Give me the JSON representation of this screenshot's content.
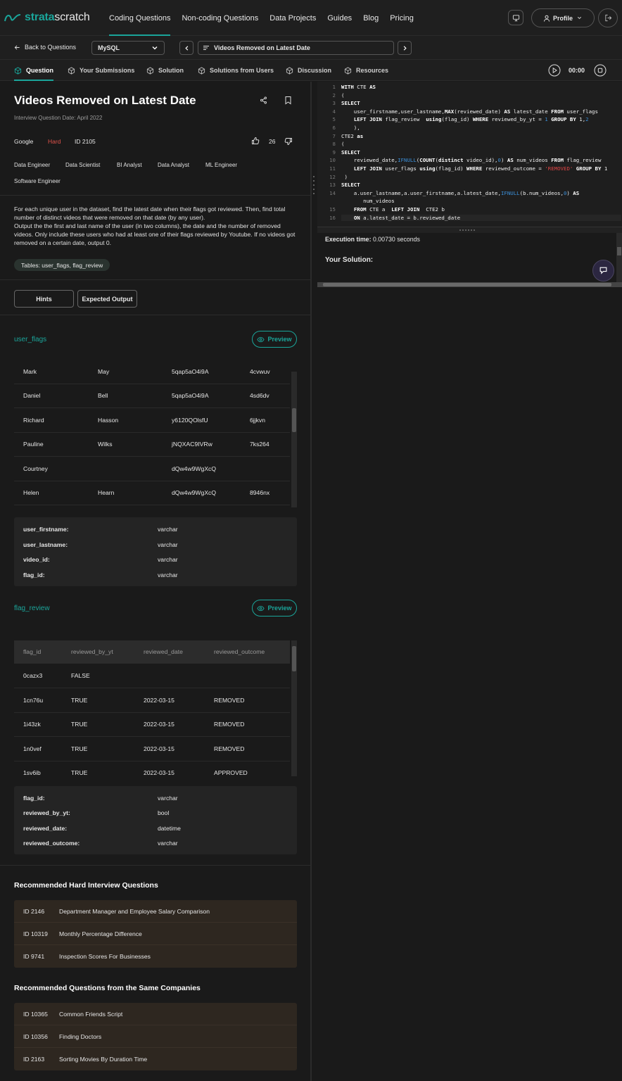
{
  "brand": {
    "logo_bold": "strata",
    "logo_rest": "scratch"
  },
  "nav": [
    "Coding Questions",
    "Non-coding Questions",
    "Data Projects",
    "Guides",
    "Blog",
    "Pricing"
  ],
  "profile_label": "Profile",
  "toolbar": {
    "back_label": "Back to Questions",
    "language": "MySQL",
    "question_title": "Videos Removed on Latest Date"
  },
  "tabs": [
    "Question",
    "Your Submissions",
    "Solution",
    "Solutions from Users",
    "Discussion",
    "Resources"
  ],
  "timer": "00:00",
  "question": {
    "title": "Videos Removed on Latest Date",
    "date": "Interview Question Date: April 2022",
    "company": "Google",
    "difficulty": "Hard",
    "id": "ID 2105",
    "likes": "26",
    "roles": [
      "Data Engineer",
      "Data Scientist",
      "BI Analyst",
      "Data Analyst",
      "ML Engineer",
      "Software Engineer"
    ],
    "description": "For each unique user in the dataset, find the latest date when their flags got reviewed. Then, find total number of distinct videos that were removed on that date (by any user).\nOutput the the first and last name of the user (in two columns), the date and the number of removed videos. Only include these users who had at least one of their flags reviewed by Youtube. If no videos got removed on a certain date, output 0.",
    "tables_pill": "Tables: user_flags, flag_review"
  },
  "buttons": {
    "hints": "Hints",
    "expected": "Expected Output",
    "preview": "Preview"
  },
  "user_flags": {
    "name": "user_flags",
    "rows": [
      [
        "Mark",
        "May",
        "5qap5aO4i9A",
        "4cvwuv"
      ],
      [
        "Daniel",
        "Bell",
        "5qap5aO4i9A",
        "4sd6dv"
      ],
      [
        "Richard",
        "Hasson",
        "y6120QOlsfU",
        "6jjkvn"
      ],
      [
        "Pauline",
        "Wilks",
        "jNQXAC9IVRw",
        "7ks264"
      ],
      [
        "Courtney",
        "",
        "dQw4w9WgXcQ",
        ""
      ],
      [
        "Helen",
        "Hearn",
        "dQw4w9WgXcQ",
        "8946nx"
      ]
    ],
    "schema": [
      [
        "user_firstname:",
        "varchar"
      ],
      [
        "user_lastname:",
        "varchar"
      ],
      [
        "video_id:",
        "varchar"
      ],
      [
        "flag_id:",
        "varchar"
      ]
    ]
  },
  "flag_review": {
    "name": "flag_review",
    "headers": [
      "flag_id",
      "reviewed_by_yt",
      "reviewed_date",
      "reviewed_outcome"
    ],
    "rows": [
      [
        "0cazx3",
        "FALSE",
        "",
        ""
      ],
      [
        "1cn76u",
        "TRUE",
        "2022-03-15",
        "REMOVED"
      ],
      [
        "1i43zk",
        "TRUE",
        "2022-03-15",
        "REMOVED"
      ],
      [
        "1n0vef",
        "TRUE",
        "2022-03-15",
        "REMOVED"
      ],
      [
        "1sv6ib",
        "TRUE",
        "2022-03-15",
        "APPROVED"
      ]
    ],
    "schema": [
      [
        "flag_id:",
        "varchar"
      ],
      [
        "reviewed_by_yt:",
        "bool"
      ],
      [
        "reviewed_date:",
        "datetime"
      ],
      [
        "reviewed_outcome:",
        "varchar"
      ]
    ]
  },
  "rec_hard": {
    "title": "Recommended Hard Interview Questions",
    "items": [
      [
        "ID 2146",
        "Department Manager and Employee Salary Comparison"
      ],
      [
        "ID 10319",
        "Monthly Percentage Difference"
      ],
      [
        "ID 9741",
        "Inspection Scores For Businesses"
      ]
    ]
  },
  "rec_same": {
    "title": "Recommended Questions from the Same Companies",
    "items": [
      [
        "ID 10365",
        "Common Friends Script"
      ],
      [
        "ID 10356",
        "Finding Doctors"
      ],
      [
        "ID 2163",
        "Sorting Movies By Duration Time"
      ]
    ]
  },
  "code_lines": [
    "WITH CTE AS",
    "(",
    "SELECT",
    "    user_firstname,user_lastname,MAX(reviewed_date) AS latest_date FROM user_flags",
    "    LEFT JOIN flag_review  using(flag_id) WHERE reviewed_by_yt = 1 GROUP BY 1,2",
    "    ),",
    "CTE2 as",
    "(",
    "SELECT",
    "    reviewed_date,IFNULL(COUNT(distinct video_id),0) AS num_videos FROM flag_review",
    "    LEFT JOIN user_flags using(flag_id) WHERE reviewed_outcome = 'REMOVED' GROUP BY 1",
    " )",
    "SELECT",
    "    a.user_lastname,a.user_firstname,a.latest_date,IFNULL(b.num_videos,0) AS",
    "       num_videos",
    "    FROM CTE a  LEFT JOIN  CTE2 b",
    "    ON a.latest_date = b.reviewed_date"
  ],
  "line_numbers": [
    "1",
    "2",
    "3",
    "4",
    "5",
    "6",
    "7",
    "8",
    "9",
    "10",
    "11",
    "12",
    "13",
    "14",
    "",
    "15",
    "16"
  ],
  "execution": {
    "label": "Execution time:",
    "value": "0.00730 seconds",
    "solution_label": "Your Solution:"
  },
  "colors": {
    "accent": "#1aa59a",
    "hard": "#e0524a",
    "bg": "#1a1a1a",
    "rec_bg": "#2e2720"
  }
}
